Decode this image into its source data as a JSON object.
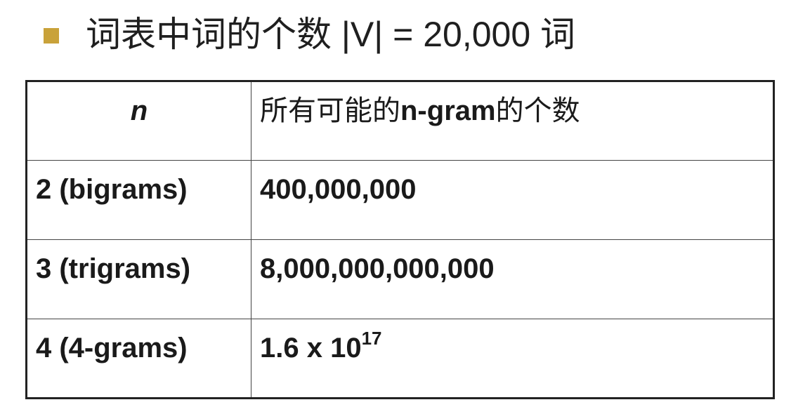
{
  "bullet": {
    "icon": "square-bullet-icon",
    "color": "#c9a23a",
    "text": "词表中词的个数 |V| = 20,000 词"
  },
  "table": {
    "header": {
      "n": "n",
      "title_prefix": "所有可能的",
      "title_bold": "n-gram",
      "title_suffix": "的个数"
    },
    "rows": [
      {
        "n": "2 (bigrams)",
        "count": "400,000,000"
      },
      {
        "n": "3 (trigrams)",
        "count": "8,000,000,000,000"
      },
      {
        "n": "4 (4-grams)",
        "count_base": "1.6 x 10",
        "count_exp": "17"
      }
    ]
  }
}
